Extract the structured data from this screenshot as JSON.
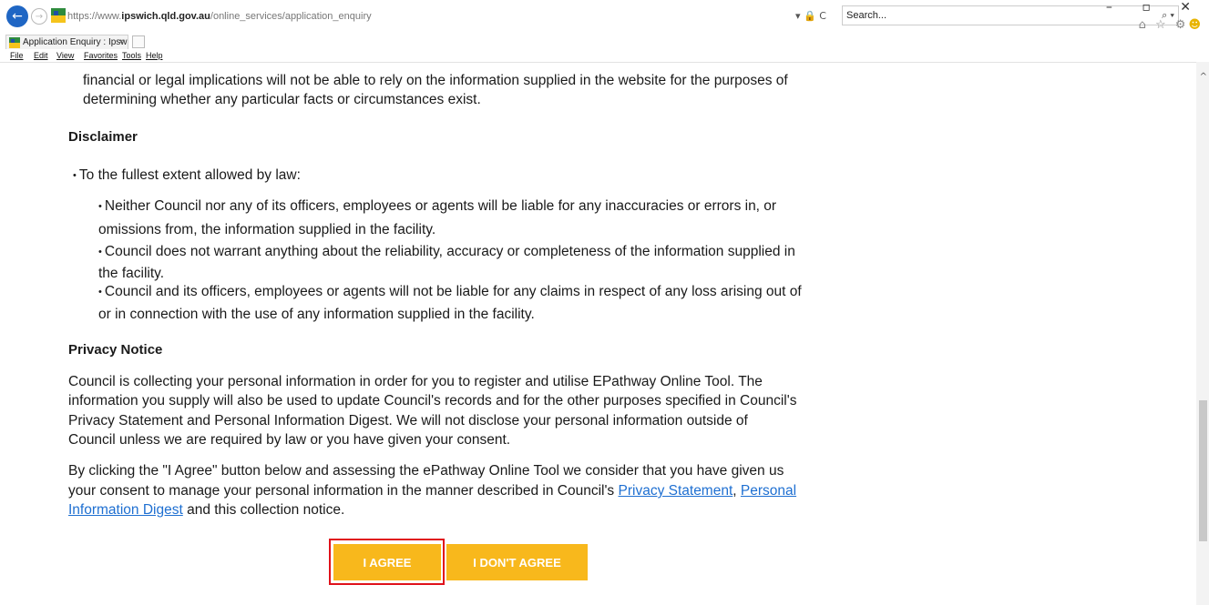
{
  "browser": {
    "url_prefix": "https://www.",
    "url_domain": "ipswich.qld.gov.au",
    "url_path": "/online_services/application_enquiry",
    "url_tools": "▾ 🔒 C",
    "search_placeholder": "Search...",
    "search_tool": "⌕ ▾",
    "window_controls": "– ▫ ✕",
    "fav_icons": "⌂ ☆ ⚙",
    "tab_title": "Application Enquiry : Ipswic...",
    "tab_close": "×",
    "menu": [
      "File",
      "Edit",
      "View",
      "Favorites",
      "Tools",
      "Help"
    ]
  },
  "content": {
    "intro_line1": "financial or legal implications will not be able to rely on the information supplied in the website for the purposes of",
    "intro_line2": "determining whether any particular facts or circumstances exist.",
    "disclaimer_heading": "Disclaimer",
    "disclaimer_lead": "To the fullest extent allowed by law:",
    "disclaimer_items": [
      {
        "line1": "Neither Council nor any of its officers, employees or agents will be liable for any inaccuracies or errors in, or",
        "line2": "omissions from, the information supplied in the facility."
      },
      {
        "line1": "Council does not warrant anything about the reliability, accuracy or completeness of the information supplied in",
        "line2": "the facility."
      },
      {
        "line1": "Council and its officers, employees or agents will not be liable for any claims in respect of any loss arising out of",
        "line2": "or in connection with the use of any information supplied in the facility."
      }
    ],
    "privacy_heading": "Privacy Notice",
    "privacy_p1": [
      "Council is collecting your personal information in order for you to register and utilise EPathway Online Tool. The",
      "information you supply will also be used to update Council's records and for the other purposes specified in Council's",
      "Privacy Statement and Personal Information Digest.  We will not disclose your personal information outside of",
      "Council unless we are required by law or you have given your consent."
    ],
    "privacy_p2_line1": "By clicking the \"I Agree\" button below and assessing the ePathway Online Tool we  consider that you have given us",
    "privacy_p2_line2_pre": "your consent to manage your personal information in the manner described in Council's ",
    "privacy_statement_link": "Privacy Statement",
    "privacy_p2_comma": ", ",
    "personal_info_link_part1": "Personal",
    "personal_info_link_part2": "Information Digest",
    "privacy_p2_line3_post": " and this collection notice."
  },
  "buttons": {
    "agree": "I AGREE",
    "disagree": "I DON'T AGREE"
  },
  "colors": {
    "button": "#f8b81c",
    "highlight": "#e0111b",
    "link": "#1e6fd1"
  }
}
